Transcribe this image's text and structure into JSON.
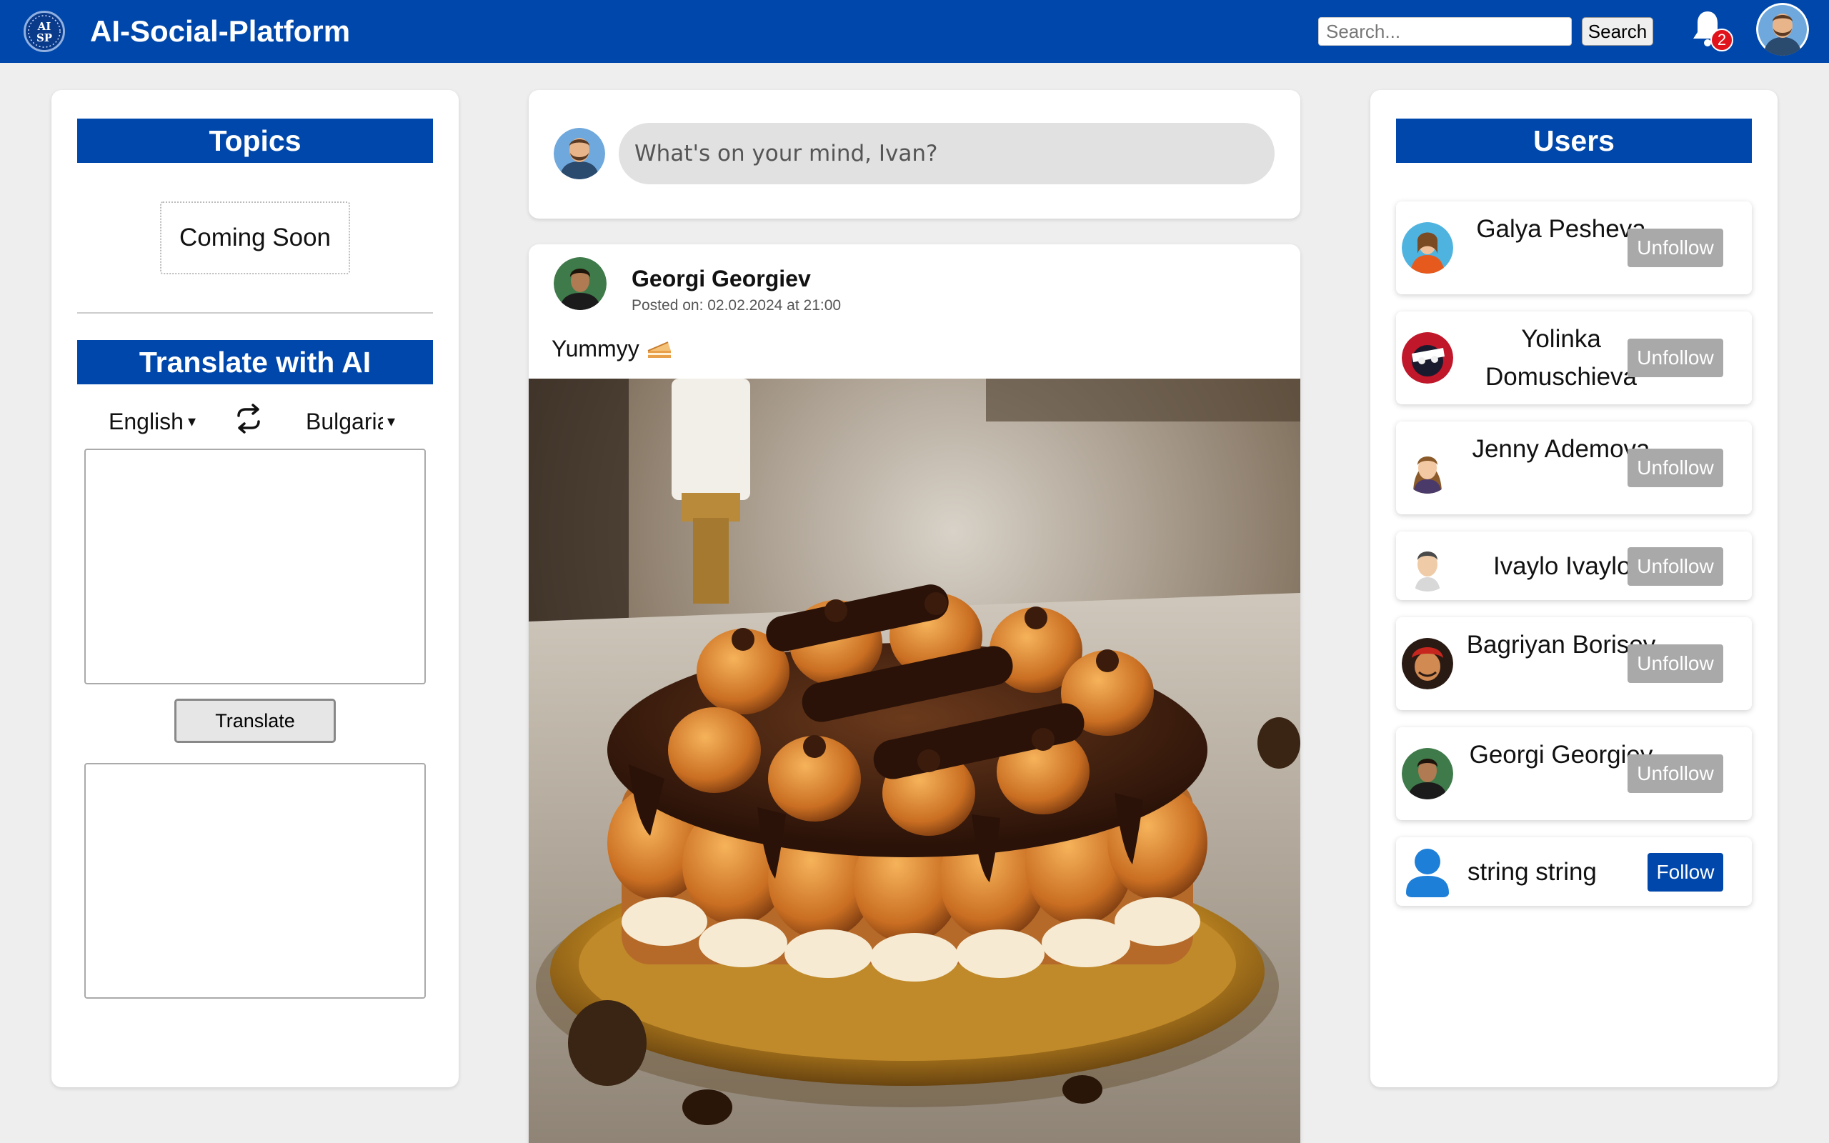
{
  "header": {
    "logo_text_top": "AI",
    "logo_text_bottom": "SP",
    "brand": "AI-Social-Platform",
    "search_placeholder": "Search...",
    "search_button": "Search",
    "notification_count": "2",
    "icons": [
      "logo-icon",
      "bell-icon",
      "avatar"
    ]
  },
  "left": {
    "topics_title": "Topics",
    "coming_soon": "Coming Soon",
    "translate_title": "Translate with AI",
    "source_language": "English",
    "target_language": "Bulgarian",
    "translate_button": "Translate",
    "input_value": "",
    "output_value": ""
  },
  "composer": {
    "placeholder": "What's on your mind, Ivan?"
  },
  "post": {
    "author": "Georgi Georgiev",
    "date": "Posted on: 02.02.2024 at 21:00",
    "text": "Yummyy",
    "emoji_icon": "cake-icon"
  },
  "users": {
    "title": "Users",
    "list": [
      {
        "name": "Galya Pesheva",
        "action": "Unfollow"
      },
      {
        "name": "Yolinka Domuschieva",
        "action": "Unfollow"
      },
      {
        "name": "Jenny Ademova",
        "action": "Unfollow"
      },
      {
        "name": "Ivaylo Ivaylov",
        "action": "Unfollow"
      },
      {
        "name": "Bagriyan Borisov",
        "action": "Unfollow"
      },
      {
        "name": "Georgi Georgiev",
        "action": "Unfollow"
      },
      {
        "name": "string string",
        "action": "Follow"
      }
    ]
  },
  "colors": {
    "primary": "#0047ab",
    "unfollow": "#a9a9a9",
    "badge": "#e0121b",
    "background": "#eeeeee"
  }
}
